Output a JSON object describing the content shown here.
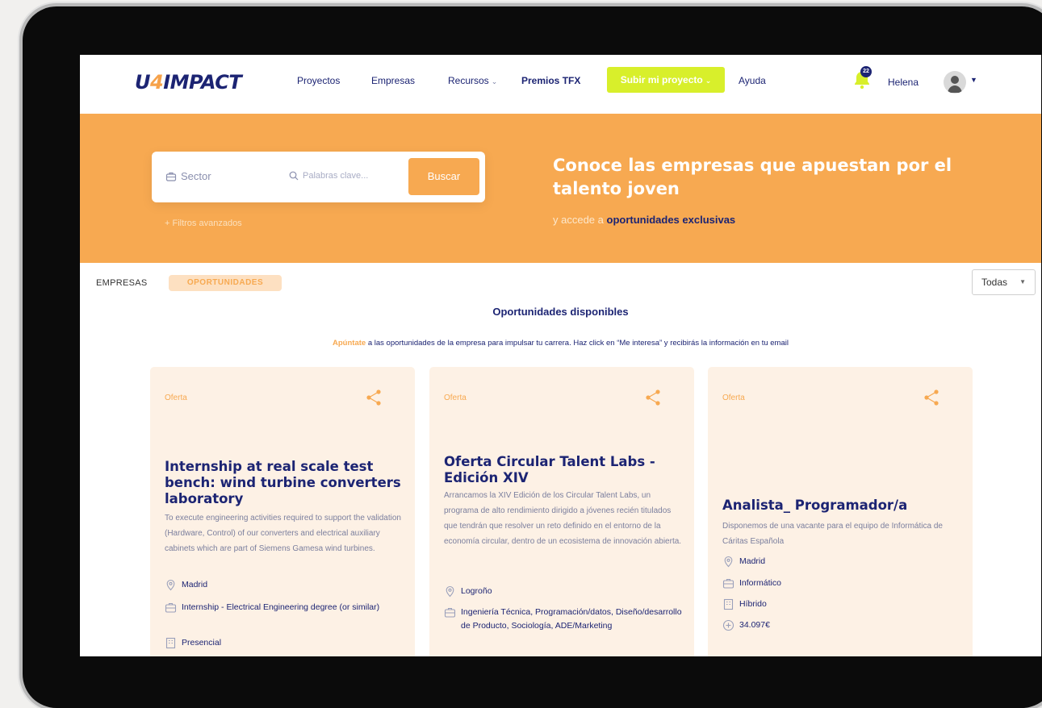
{
  "nav": {
    "logo_prefix": "U",
    "logo_four": "4",
    "logo_suffix": "IMPACT",
    "links": [
      "Proyectos",
      "Empresas",
      "Recursos",
      "Premios TFX"
    ],
    "upload_button": "Subir mi proyecto",
    "help": "Ayuda",
    "notification_count": "22",
    "user_name": "Helena"
  },
  "hero": {
    "sector_label": "Sector",
    "keywords_placeholder": "Palabras clave...",
    "search_button": "Buscar",
    "advanced_filters": "+ Filtros avanzados",
    "title": "Conoce las empresas que apuestan por el talento joven",
    "subtitle_prefix": "y accede a",
    "subtitle_link": "oportunidades exclusivas"
  },
  "tabs": {
    "empresas": "EMPRESAS",
    "oportunidades": "OPORTUNIDADES",
    "filter_value": "Todas"
  },
  "section": {
    "title": "Oportunidades disponibles",
    "subtitle_highlight": "Apúntate",
    "subtitle_rest": " a las oportunidades de la empresa para impulsar tu carrera. Haz click en “Me interesa” y recibirás la información en tu email"
  },
  "cards": [
    {
      "tag": "Oferta",
      "title": "Internship at real scale test bench: wind turbine converters laboratory",
      "description": "To execute engineering activities required to support the validation (Hardware, Control) of our converters and electrical auxiliary cabinets which are part of Siemens Gamesa wind turbines.",
      "location": "Madrid",
      "area": "Internship - Electrical Engineering degree (or similar)",
      "modality": "Presencial"
    },
    {
      "tag": "Oferta",
      "title": "Oferta Circular Talent Labs - Edición XIV",
      "description": "Arrancamos la XIV Edición de los Circular Talent Labs, un programa de alto rendimiento dirigido a jóvenes recién titulados que tendrán que resolver un reto definido en el entorno de la economía circular, dentro de un ecosistema de innovación abierta.",
      "location": "Logroño",
      "area": "Ingeniería Técnica, Programación/datos, Diseño/desarrollo de Producto, Sociología, ADE/Marketing"
    },
    {
      "tag": "Oferta",
      "title": "Analista_ Programador/a",
      "description": "Disponemos de una vacante para el equipo de Informática de Cáritas Española",
      "location": "Madrid",
      "area": "Informático",
      "modality": "Híbrido",
      "salary": "34.097€"
    }
  ],
  "colors": {
    "brand_orange": "#f7a951",
    "brand_navy": "#1c2473",
    "accent_lime": "#d8ef2b"
  }
}
